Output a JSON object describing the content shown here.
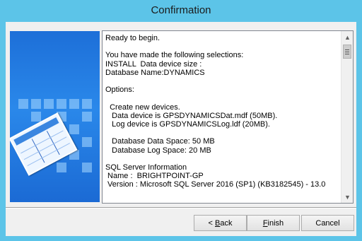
{
  "window": {
    "title": "Confirmation"
  },
  "summary": {
    "lines": [
      "Ready to begin.",
      "",
      "You have made the following selections:",
      "INSTALL  Data device size :",
      "Database Name:DYNAMICS",
      "",
      "Options:",
      "",
      "  Create new devices.",
      "   Data device is GPSDYNAMICSDat.mdf (50MB).",
      "   Log device is GPSDYNAMICSLog.ldf (20MB).",
      "",
      "   Database Data Space: 50 MB",
      "   Database Log Space: 20 MB",
      "",
      "SQL Server Information",
      " Name :  BRIGHTPOINT-GP",
      " Version : Microsoft SQL Server 2016 (SP1) (KB3182545) - 13.0"
    ]
  },
  "scrollbar": {
    "up_icon": "scroll-up-arrow",
    "down_icon": "scroll-down-arrow"
  },
  "buttons": {
    "back_prefix": "< ",
    "back_mnemonic": "B",
    "back_rest": "ack",
    "finish_mnemonic": "F",
    "finish_rest": "inish",
    "cancel_label": "Cancel"
  },
  "colors": {
    "frame": "#5cc4e8",
    "client": "#f0f0f0",
    "side_panel": "#1d6fd8"
  }
}
